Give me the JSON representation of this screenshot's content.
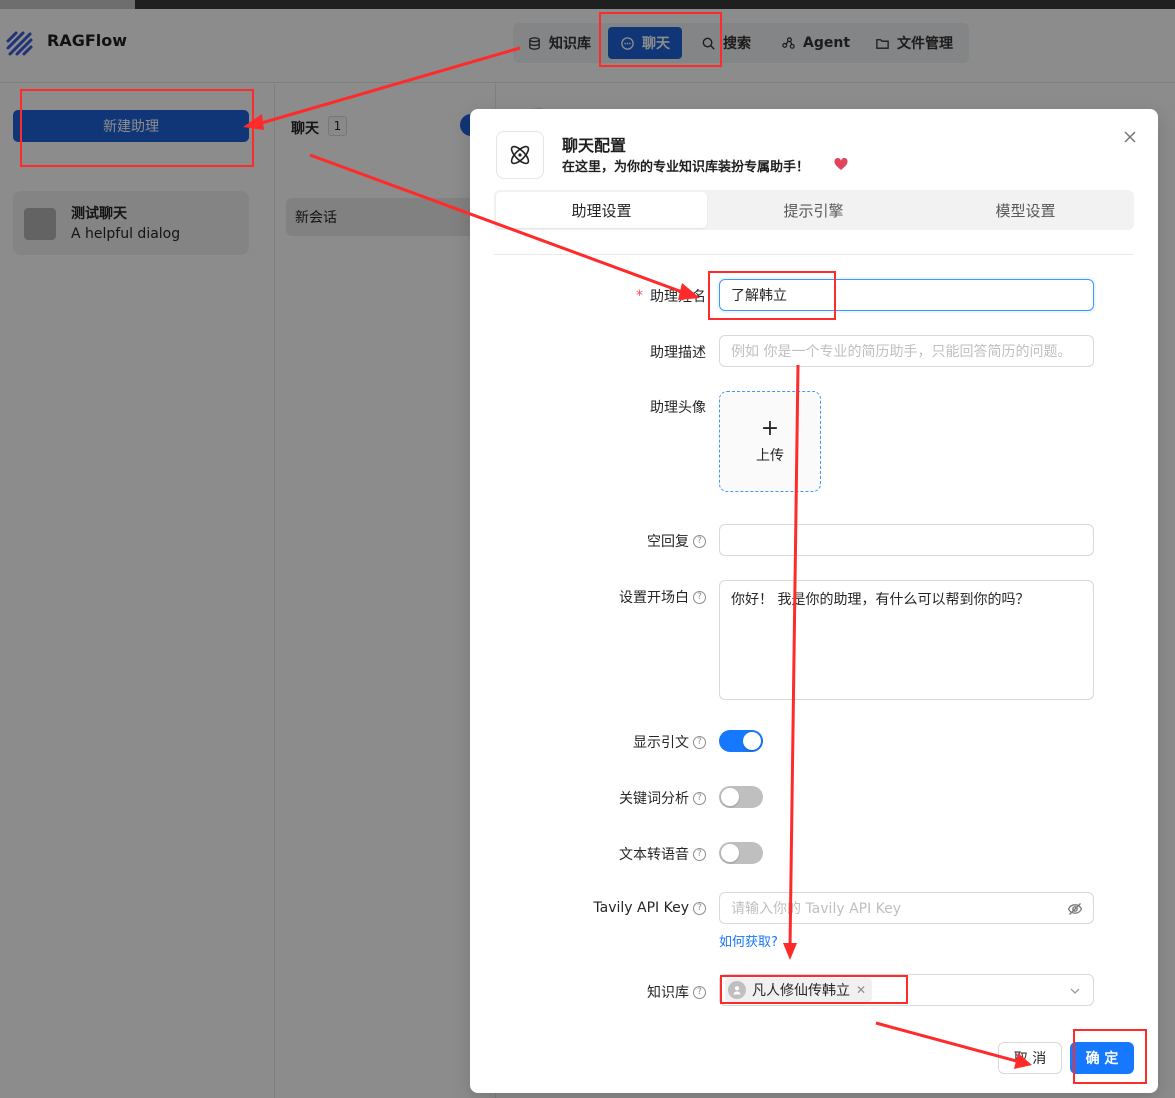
{
  "app": {
    "brand": "RAGFlow"
  },
  "nav": {
    "items": [
      {
        "label": "知识库",
        "icon": "database-icon"
      },
      {
        "label": "聊天",
        "icon": "chat-icon",
        "active": true
      },
      {
        "label": "搜索",
        "icon": "search-icon"
      },
      {
        "label": "Agent",
        "icon": "agent-icon"
      },
      {
        "label": "文件管理",
        "icon": "folder-icon"
      }
    ]
  },
  "sidebar": {
    "new_button": "新建助理",
    "assistants": [
      {
        "title": "测试聊天",
        "description": "A helpful dialog"
      }
    ]
  },
  "chats": {
    "title": "聊天",
    "count": "1",
    "items": [
      "新会话"
    ]
  },
  "modal": {
    "title": "聊天配置",
    "subtitle": "在这里，为你的专业知识库装扮专属助手！",
    "tabs": [
      "助理设置",
      "提示引擎",
      "模型设置"
    ],
    "active_tab": 0,
    "fields": {
      "name": {
        "label": "助理姓名",
        "value": "了解韩立"
      },
      "description": {
        "label": "助理描述",
        "placeholder": "例如 你是一个专业的简历助手，只能回答简历的问题。"
      },
      "avatar": {
        "label": "助理头像",
        "upload": "上传"
      },
      "empty_reply": {
        "label": "空回复",
        "value": ""
      },
      "opener": {
        "label": "设置开场白",
        "value": "你好！ 我是你的助理，有什么可以帮到你的吗？"
      },
      "show_quote": {
        "label": "显示引文",
        "on": true
      },
      "keyword": {
        "label": "关键词分析",
        "on": false
      },
      "tts": {
        "label": "文本转语音",
        "on": false
      },
      "tavily": {
        "label": "Tavily API Key",
        "placeholder": "请输入你的 Tavily API Key",
        "link": "如何获取?"
      },
      "kb": {
        "label": "知识库",
        "selected": "凡人修仙传韩立"
      }
    },
    "cancel": "取 消",
    "ok": "确 定"
  },
  "colors": {
    "accent": "#1677ff",
    "annotation": "#ff2a2a"
  }
}
